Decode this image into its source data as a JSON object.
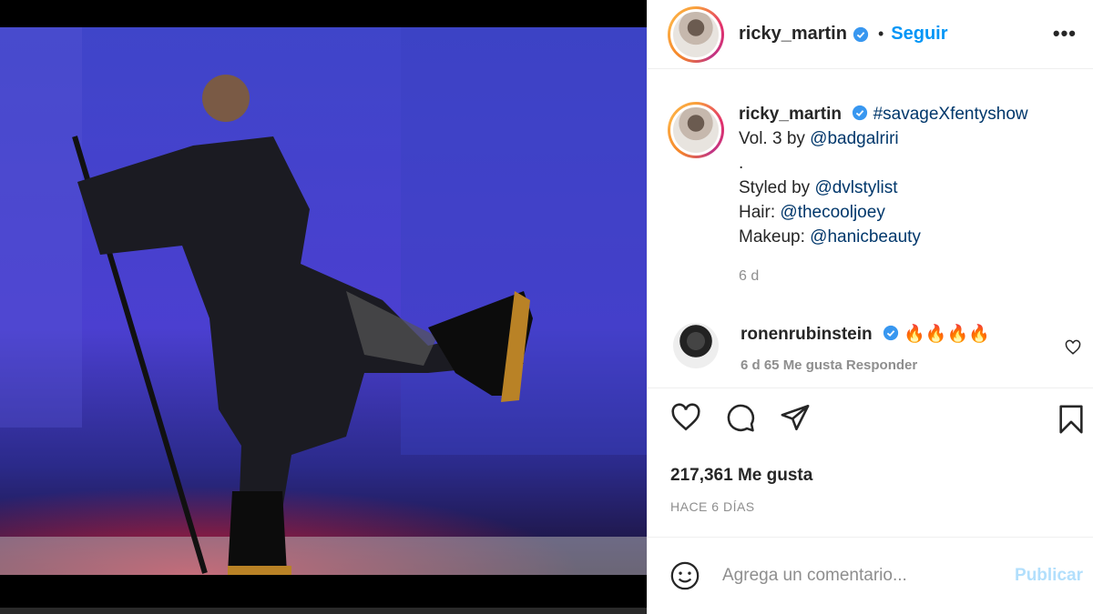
{
  "post": {
    "username": "ricky_martin",
    "follow_label": "Seguir",
    "separator": "•",
    "more_label": "•••"
  },
  "caption": {
    "username": "ricky_martin",
    "hashtag": "#savageXfentyshow",
    "line1_prefix": "Vol. 3 by ",
    "mention1": "@badgalriri",
    "dot_line": ".",
    "line3_prefix": "Styled by ",
    "mention2": "@dvlstylist",
    "line4_prefix": "Hair: ",
    "mention3": "@thecooljoey",
    "line5_prefix": "Makeup: ",
    "mention4": "@hanicbeauty",
    "time": "6 d"
  },
  "comment": {
    "username": "ronenrubinstein",
    "text": "🔥🔥🔥🔥",
    "meta": "6 d    65 Me gusta    Responder"
  },
  "stats": {
    "likes": "217,361 Me gusta",
    "date": "HACE 6 DÍAS"
  },
  "add_comment": {
    "placeholder": "Agrega un comentario...",
    "publish_label": "Publicar"
  },
  "colors": {
    "accent": "#0095f6",
    "link": "#00376b",
    "muted": "#8e8e8e"
  }
}
